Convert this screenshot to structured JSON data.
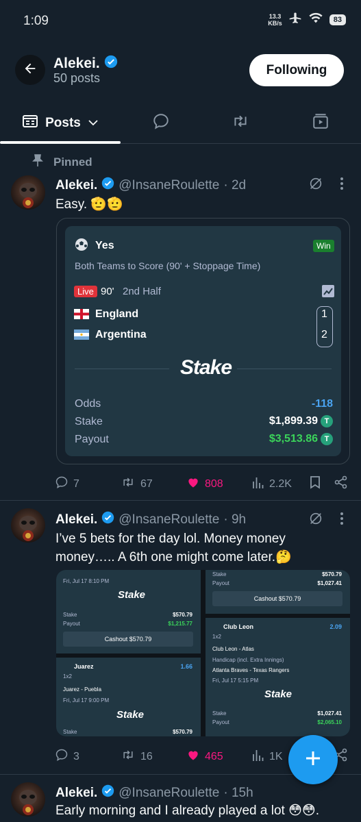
{
  "status_bar": {
    "time": "1:09",
    "net_speed_value": "13.3",
    "net_speed_unit": "KB/s",
    "battery": "83"
  },
  "header": {
    "name": "Alekei.",
    "posts_count": "50 posts",
    "follow_label": "Following"
  },
  "tabs": {
    "posts_label": "Posts"
  },
  "pinned_label": "Pinned",
  "post1": {
    "name": "Alekei.",
    "handle": "@InsaneRoulette",
    "time": "· 2d",
    "text": "Easy. 🫡🫡",
    "replies": "7",
    "reposts": "67",
    "likes": "808",
    "views": "2.2K",
    "bet": {
      "selection": "Yes",
      "result": "Win",
      "market": "Both Teams to Score (90' + Stoppage Time)",
      "live": "Live",
      "minute": "90'",
      "period": "2nd Half",
      "team1": "England",
      "score1": "1",
      "team2": "Argentina",
      "score2": "2",
      "brand": "Stake",
      "odds_label": "Odds",
      "odds_value": "-118",
      "stake_label": "Stake",
      "stake_value": "$1,899.39",
      "payout_label": "Payout",
      "payout_value": "$3,513.86",
      "currency_symbol": "T"
    }
  },
  "post2": {
    "name": "Alekei.",
    "handle": "@InsaneRoulette",
    "time": "· 9h",
    "text_line1": "I’ve 5 bets for the day lol. Money money",
    "text_line2": "money….. A 6th one might come later.🤔",
    "replies": "3",
    "reposts": "16",
    "likes": "465",
    "views": "1K",
    "collage": {
      "left_top_date": "Fri, Jul 17  8:10 PM",
      "brand": "Stake",
      "stake_label": "Stake",
      "stake_value_1": "$570.79",
      "payout_label": "Payout",
      "payout_value_1": "$1,215.77",
      "cashout_1": "Cashout $570.79",
      "juarez_title": "Juarez",
      "juarez_odds": "1.66",
      "market_1x2": "1x2",
      "juarez_match": "Juarez - Puebla",
      "juarez_date": "Fri, Jul 17  9:00 PM",
      "stake_value_2": "$570.79",
      "right_stake_value": "$570.79",
      "right_payout_value": "$1,027.41",
      "cashout_2": "Cashout $570.79",
      "leon_title": "Club Leon",
      "leon_odds": "2.09",
      "leon_match": "Club Leon - Atlas",
      "handicap": "Handicap (incl. Extra Innings)",
      "braves_match": "Atlanta Braves - Texas Rangers",
      "braves_date": "Fri, Jul 17  5:15 PM",
      "braves_stake": "$1,027.41",
      "braves_payout": "$2,065.10"
    }
  },
  "post3": {
    "name": "Alekei.",
    "handle": "@InsaneRoulette",
    "time": "· 15h",
    "text": "Early morning and I already played a lot 😳😳."
  },
  "colors": {
    "accent": "#1d9bf0",
    "like": "#f91880",
    "win_green": "#1a7f2e",
    "payout_green": "#3bd45a",
    "odds_blue": "#4aa3f0"
  }
}
